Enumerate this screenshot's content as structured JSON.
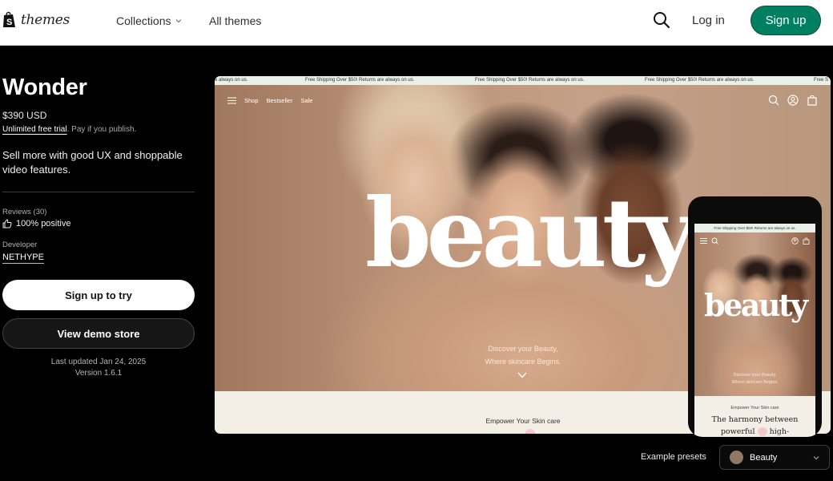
{
  "topnav": {
    "logo_text": "themes",
    "collections": "Collections",
    "all_themes": "All themes",
    "login": "Log in",
    "signup": "Sign up",
    "signup_color": "#008060"
  },
  "theme": {
    "title": "Wonder",
    "price": "$390 USD",
    "trial_link": "Unlimited free trial",
    "trial_rest": ". Pay if you publish.",
    "description": "Sell more with good UX and shoppable video features.",
    "reviews_label": "Reviews (30)",
    "reviews_positive": "100% positive",
    "developer_label": "Developer",
    "developer": "NETHYPE",
    "try_button": "Sign up to try",
    "demo_button": "View demo store",
    "last_updated": "Last updated Jan 24, 2025",
    "version": "Version 1.6.1"
  },
  "preview": {
    "announcement": "Free Shipping Over $50! Returns are always on us.",
    "announcement_fragment": "e always on us.",
    "announcement_tail": "Free S",
    "nav": [
      "Shop",
      "Bestseller",
      "Sale"
    ],
    "hero_word": "beauty",
    "tagline_1": "Discover your Beauty,",
    "tagline_2": "Where skincare Begins.",
    "section_label": "Empower Your Skin care"
  },
  "phone_preview": {
    "announcement": "Free Shipping Over $50! Returns are always on us.",
    "hero_word": "beauty",
    "tagline_1": "Discover your Beauty,",
    "tagline_2": "Where skincare Begins.",
    "section_label": "Empower Your Skin care",
    "headline_1": "The harmony between",
    "headline_2a": "powerful",
    "headline_2b": "high-"
  },
  "presets": {
    "label": "Example presets",
    "selected": "Beauty",
    "swatch_color": "#8e7a64"
  }
}
